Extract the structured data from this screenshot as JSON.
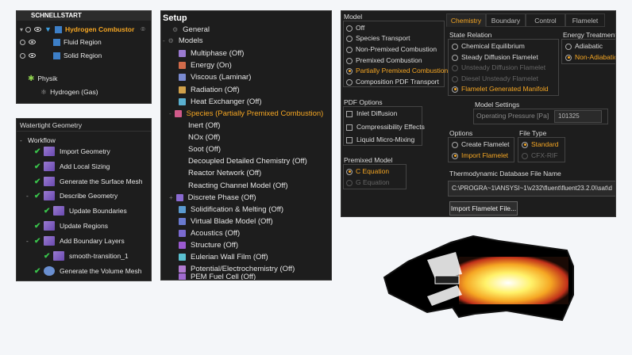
{
  "outline": {
    "header": "SCHNELLSTART",
    "root": "Hydrogen Combustor",
    "regions": [
      "Fluid Region",
      "Solid Region"
    ],
    "physics": "Physik",
    "material": "Hydrogen (Gas)"
  },
  "workflow": {
    "title": "Watertight Geometry",
    "group": "Workflow",
    "steps": [
      "Import Geometry",
      "Add Local Sizing",
      "Generate the Surface Mesh",
      "Describe Geometry",
      "Update Boundaries",
      "Update Regions",
      "Add Boundary Layers",
      "smooth-transition_1",
      "Generate the Volume Mesh"
    ]
  },
  "setup": {
    "title": "Setup",
    "general": "General",
    "models": "Models",
    "items": [
      "Multiphase (Off)",
      "Energy (On)",
      "Viscous (Laminar)",
      "Radiation (Off)",
      "Heat Exchanger (Off)",
      "Species (Partially Premixed Combustion)",
      "Inert (Off)",
      "NOx (Off)",
      "Soot (Off)",
      "Decoupled Detailed Chemistry (Off)",
      "Reactor Network (Off)",
      "Reacting Channel Model (Off)",
      "Discrete Phase (Off)",
      "Solidification & Melting (Off)",
      "Virtual Blade Model (Off)",
      "Acoustics (Off)",
      "Structure (Off)",
      "Eulerian Wall Film (Off)",
      "Potential/Electrochemistry (Off)",
      "PEM Fuel Cell (Off)"
    ]
  },
  "species": {
    "model_label": "Model",
    "models": [
      "Off",
      "Species Transport",
      "Non-Premixed Combustion",
      "Premixed Combustion",
      "Partially Premixed Combustion",
      "Composition PDF Transport"
    ],
    "pdf_label": "PDF Options",
    "pdf_options": [
      "Inlet Diffusion",
      "Compressibility Effects",
      "Liquid Micro-Mixing"
    ],
    "premixed_label": "Premixed Model",
    "premixed": [
      "C Equation",
      "G Equation"
    ],
    "tabs": [
      "Chemistry",
      "Boundary",
      "Control",
      "Flamelet"
    ],
    "state_label": "State Relation",
    "state": [
      "Chemical Equilibrium",
      "Steady Diffusion Flamelet",
      "Unsteady Diffusion Flamelet",
      "Diesel Unsteady Flamelet",
      "Flamelet Generated Manifold"
    ],
    "energy_label": "Energy Treatment",
    "energy": [
      "Adiabatic",
      "Non-Adiabatic"
    ],
    "settings_label": "Model Settings",
    "pressure_label": "Operating Pressure [Pa]",
    "pressure_value": "101325",
    "options_label": "Options",
    "options": [
      "Create Flamelet",
      "Import Flamelet"
    ],
    "filetype_label": "File Type",
    "filetypes": [
      "Standard",
      "CFX-RIF"
    ],
    "db_label": "Thermodynamic Database File Name",
    "db_path": "C:\\PROGRA~1\\ANSYSI~1\\v232\\fluent\\fluent23.2.0\\\\sat\\d",
    "import_button": "Import Flamelet File..."
  },
  "colors": {
    "accent": "#f5a623",
    "panel": "#1d1d1d",
    "check": "#39c24a"
  }
}
